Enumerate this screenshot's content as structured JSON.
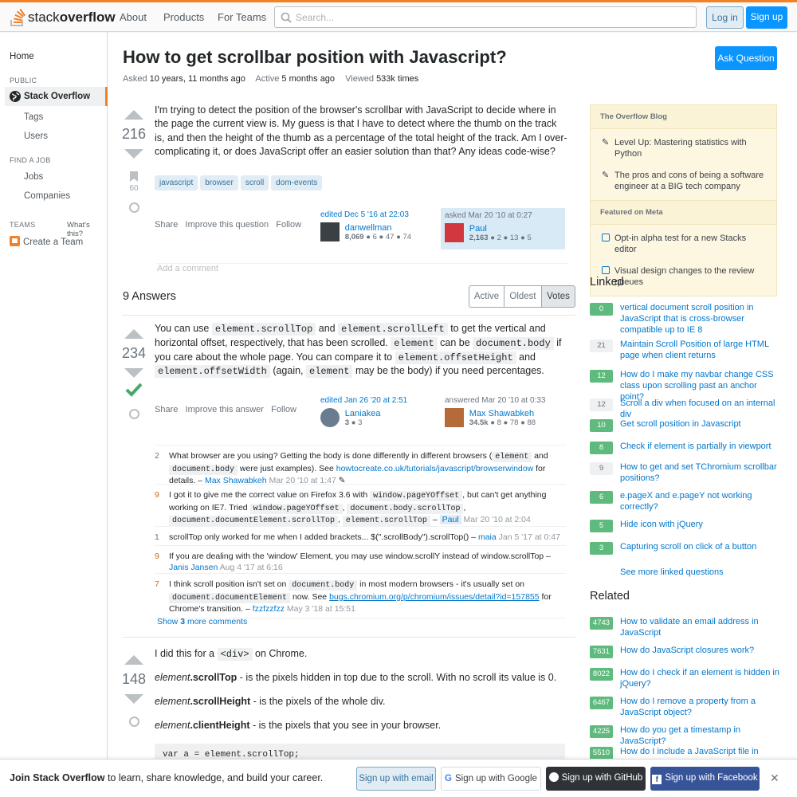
{
  "header": {
    "logo_a": "stack",
    "logo_b": "overflow",
    "nav": [
      "About",
      "Products",
      "For Teams"
    ],
    "search_placeholder": "Search...",
    "login": "Log in",
    "signup": "Sign up"
  },
  "leftnav": {
    "home": "Home",
    "public": "PUBLIC",
    "so": "Stack Overflow",
    "tags": "Tags",
    "users": "Users",
    "find_job": "FIND A JOB",
    "jobs": "Jobs",
    "companies": "Companies",
    "teams": "TEAMS",
    "whats_this": "What's this?",
    "create_team": "Create a Team"
  },
  "question": {
    "title": "How to get scrollbar position with Javascript?",
    "asked_label": "Asked",
    "asked": "10 years, 11 months ago",
    "active_label": "Active",
    "active": "5 months ago",
    "viewed_label": "Viewed",
    "viewed": "533k times",
    "ask_button": "Ask Question",
    "score": "216",
    "bookmarks": "60",
    "body": "I'm trying to detect the position of the browser's scrollbar with JavaScript to decide where in the page the current view is. My guess is that I have to detect where the thumb on the track is, and then the height of the thumb as a percentage of the total height of the track. Am I over-complicating it, or does JavaScript offer an easier solution than that? Any ideas code-wise?",
    "tags": [
      "javascript",
      "browser",
      "scroll",
      "dom-events"
    ],
    "share": "Share",
    "improve": "Improve this question",
    "follow": "Follow",
    "edited": "edited Dec 5 '16 at 22:03",
    "editor": "danwellman",
    "editor_rep": "8,069",
    "editor_badges": "● 6  ● 47  ● 74",
    "asked_when": "asked Mar 20 '10 at 0:27",
    "asker": "Paul",
    "asker_rep": "2,163",
    "asker_badges": "● 2  ● 13  ● 5",
    "add_comment": "Add a comment"
  },
  "answers_header": {
    "count": "9 Answers",
    "sort": [
      "Active",
      "Oldest",
      "Votes"
    ]
  },
  "answer1": {
    "score": "234",
    "p1": "You can use",
    "c1": "element.scrollTop",
    "p2": "and",
    "c2": "element.scrollLeft",
    "p3": "to get the vertical and horizontal offset, respectively, that has been scrolled.",
    "c3": "element",
    "p4": "can be",
    "c4": "document.body",
    "p5": "if you care about the whole page. You can compare it to",
    "c5": "element.offsetHeight",
    "p6": "and",
    "c6": "element.offsetWidth",
    "p7": "(again,",
    "c7": "element",
    "p8": "may be the body) if you need percentages.",
    "share": "Share",
    "improve": "Improve this answer",
    "follow": "Follow",
    "edited": "edited Jan 26 '20 at 2:51",
    "editor": "Laniakea",
    "editor_rep": "3",
    "editor_badges": "● 3",
    "answered": "answered Mar 20 '10 at 0:33",
    "answerer": "Max Shawabkeh",
    "answerer_rep": "34.5k",
    "answerer_badges": "● 8  ● 78  ● 88"
  },
  "comments": [
    {
      "score": "2",
      "hot": false,
      "html": "What browser are you using? Getting the body is done differently in different browsers (<code>element</code> and <code>document.body</code> were just examples). See <a>howtocreate.co.uk/tutorials/javascript/browserwindow</a> for details. – <span class='u'>Max Shawabkeh</span> <span class='t'>Mar 20 '10 at 1:47</span> ✎"
    },
    {
      "score": "9",
      "hot": true,
      "html": "I got it to give me the correct value on Firefox 3.6 with <code>window.pageYOffset</code>, but can't get anything working on IE7. Tried <code>window.pageYOffset</code>, <code>document.body.scrollTop</code>, <code>document.documentElement.scrollTop</code>, <code>element.scrollTop</code> – <span class='u' style='background:#e1ecf4;padding:0 3px'>Paul</span> <span class='t'>Mar 20 '10 at 2:04</span>"
    },
    {
      "score": "1",
      "hot": false,
      "html": "scrollTop only worked for me when I added brackets... $(\".scrollBody\").scrollTop() – <span class='u'>maia</span> <span class='t'>Jan 5 '17 at 0:47</span>"
    },
    {
      "score": "9",
      "hot": true,
      "html": "If you are dealing with the 'window' Element, you may use window.scrollY instead of window.scrollTop – <span class='u'>Janis Jansen</span> <span class='t'>Aug 4 '17 at 6:16</span>"
    },
    {
      "score": "7",
      "hot": true,
      "html": "I think scroll position isn't set on <code>document.body</code> in most modern browsers - it's usually set on <code>document.documentElement</code> now. See <a style='text-decoration:underline'>bugs.chromium.org/p/chromium/issues/detail?id=157855</a> for Chrome's transition. – <span class='u'>fzzfzzfzz</span> <span class='t'>May 3 '18 at 15:51</span>"
    }
  ],
  "show_more": {
    "a": "Show",
    "b": "3",
    "c": "more comments"
  },
  "answer2": {
    "score": "148",
    "l1a": "I did this for a",
    "l1c": "<div>",
    "l1b": "on Chrome.",
    "l2em": "element",
    "l2b": ".scrollTop",
    "l2t": " - is the pixels hidden in top due to the scroll. With no scroll its value is 0.",
    "l3em": "element",
    "l3b": ".scrollHeight",
    "l3t": " - is the pixels of the whole div.",
    "l4em": "element",
    "l4b": ".clientHeight",
    "l4t": " - is the pixels that you see in your browser.",
    "code": "var a = element.scrollTop;"
  },
  "blog": {
    "title": "The Overflow Blog",
    "items": [
      "Level Up: Mastering statistics with Python",
      "The pros and cons of being a software engineer at a BIG tech company"
    ],
    "meta_title": "Featured on Meta",
    "meta_items": [
      "Opt-in alpha test for a new Stacks editor",
      "Visual design changes to the review queues"
    ]
  },
  "linked": {
    "title": "Linked",
    "items": [
      {
        "n": "0",
        "g": true,
        "t": "vertical document scroll position in JavaScript that is cross-browser compatible up to IE 8"
      },
      {
        "n": "21",
        "g": false,
        "t": "Maintain Scroll Position of large HTML page when client returns"
      },
      {
        "n": "12",
        "g": true,
        "t": "How do I make my navbar change CSS class upon scrolling past an anchor point?"
      },
      {
        "n": "12",
        "g": false,
        "t": "Scroll a div when focused on an internal div"
      },
      {
        "n": "10",
        "g": true,
        "t": "Get scroll position in Javascript"
      },
      {
        "n": "8",
        "g": true,
        "t": "Check if element is partially in viewport"
      },
      {
        "n": "9",
        "g": false,
        "t": "How to get and set TChromium scrollbar positions?"
      },
      {
        "n": "6",
        "g": true,
        "t": "e.pageX and e.pageY not working correctly?"
      },
      {
        "n": "5",
        "g": true,
        "t": "Hide icon with jQuery"
      },
      {
        "n": "3",
        "g": true,
        "t": "Capturing scroll on click of a button"
      }
    ],
    "more": "See more linked questions"
  },
  "related": {
    "title": "Related",
    "items": [
      {
        "n": "4743",
        "t": "How to validate an email address in JavaScript"
      },
      {
        "n": "7631",
        "t": "How do JavaScript closures work?"
      },
      {
        "n": "8022",
        "t": "How do I check if an element is hidden in jQuery?"
      },
      {
        "n": "6467",
        "t": "How do I remove a property from a JavaScript object?"
      },
      {
        "n": "4225",
        "t": "How do you get a timestamp in JavaScript?"
      },
      {
        "n": "5510",
        "t": "How do I include a JavaScript file in"
      }
    ]
  },
  "footer": {
    "join_b": "Join Stack Overflow",
    "join_t": " to learn, share knowledge, and build your career.",
    "email": "Sign up with email",
    "google": "Sign up with Google",
    "github": "Sign up with GitHub",
    "facebook": "Sign up with Facebook",
    "close": "✕"
  }
}
